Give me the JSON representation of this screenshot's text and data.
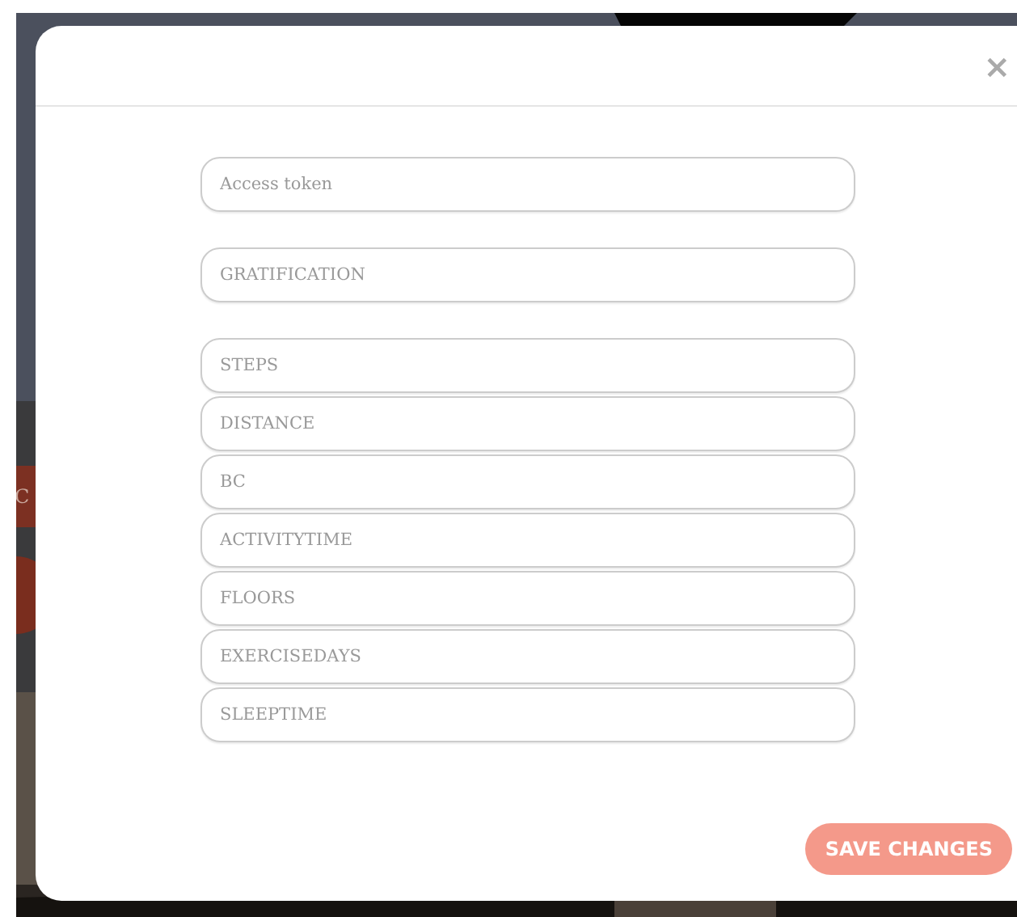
{
  "background": {
    "button_fragment": "C"
  },
  "modal": {
    "close": "×",
    "field_groups": [
      {
        "fields": [
          {
            "placeholder": "Access token"
          }
        ]
      },
      {
        "fields": [
          {
            "placeholder": "GRATIFICATION"
          }
        ]
      },
      {
        "fields": [
          {
            "placeholder": "STEPS"
          },
          {
            "placeholder": "DISTANCE"
          },
          {
            "placeholder": "BC"
          },
          {
            "placeholder": "ACTIVITYTIME"
          },
          {
            "placeholder": "FLOORS"
          },
          {
            "placeholder": "EXERCISEDAYS"
          },
          {
            "placeholder": "SLEEPTIME"
          }
        ]
      }
    ],
    "save_button": "SAVE CHANGES"
  }
}
